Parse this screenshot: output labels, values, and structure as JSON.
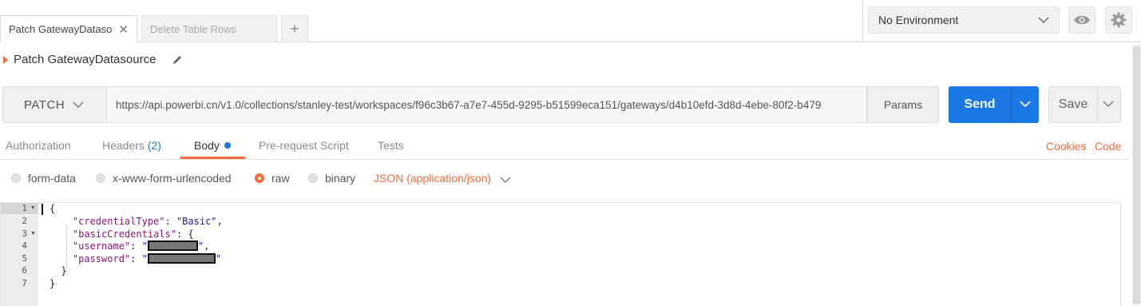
{
  "tabs": [
    {
      "label": "Patch GatewayDataso",
      "active": true
    },
    {
      "label": "Delete Table Rows",
      "active": false
    }
  ],
  "add_tab_symbol": "+",
  "close_symbol": "✕",
  "environment": {
    "selected": "No Environment"
  },
  "request": {
    "name": "Patch GatewayDatasource"
  },
  "url_bar": {
    "method": "PATCH",
    "url": "https://api.powerbi.cn/v1.0/collections/stanley-test/workspaces/f96c3b67-a7e7-455d-9295-b51599eca151/gateways/d4b10efd-3d8d-4ebe-80f2-b479",
    "params_label": "Params",
    "send_label": "Send",
    "save_label": "Save"
  },
  "sub_tabs": {
    "authorization": "Authorization",
    "headers": "Headers",
    "headers_count": "(2)",
    "body": "Body",
    "pre_request": "Pre-request Script",
    "tests": "Tests",
    "cookies": "Cookies",
    "code": "Code"
  },
  "body_types": {
    "form_data": "form-data",
    "urlencoded": "x-www-form-urlencoded",
    "raw": "raw",
    "binary": "binary",
    "selected": "raw",
    "content_type": "JSON (application/json)"
  },
  "editor": {
    "line_numbers": [
      "1",
      "2",
      "3",
      "4",
      "5",
      "6",
      "7"
    ],
    "open_brace": "{",
    "credential_type_key": "\"credentialType\"",
    "credential_type_value": "\"Basic\"",
    "basic_credentials_key": "\"basicCredentials\"",
    "username_key": "\"username\"",
    "password_key": "\"password\"",
    "colon": ": ",
    "comma": ",",
    "quote": "\"",
    "inner_open": "{",
    "inner_close": "}",
    "outer_close": "}"
  },
  "colors": {
    "accent": "#f26b3a",
    "send": "#1b79e5"
  },
  "icons": [
    "chevron-down-icon",
    "eye-icon",
    "gear-icon",
    "pencil-icon",
    "close-icon",
    "fold-arrow-icon"
  ]
}
